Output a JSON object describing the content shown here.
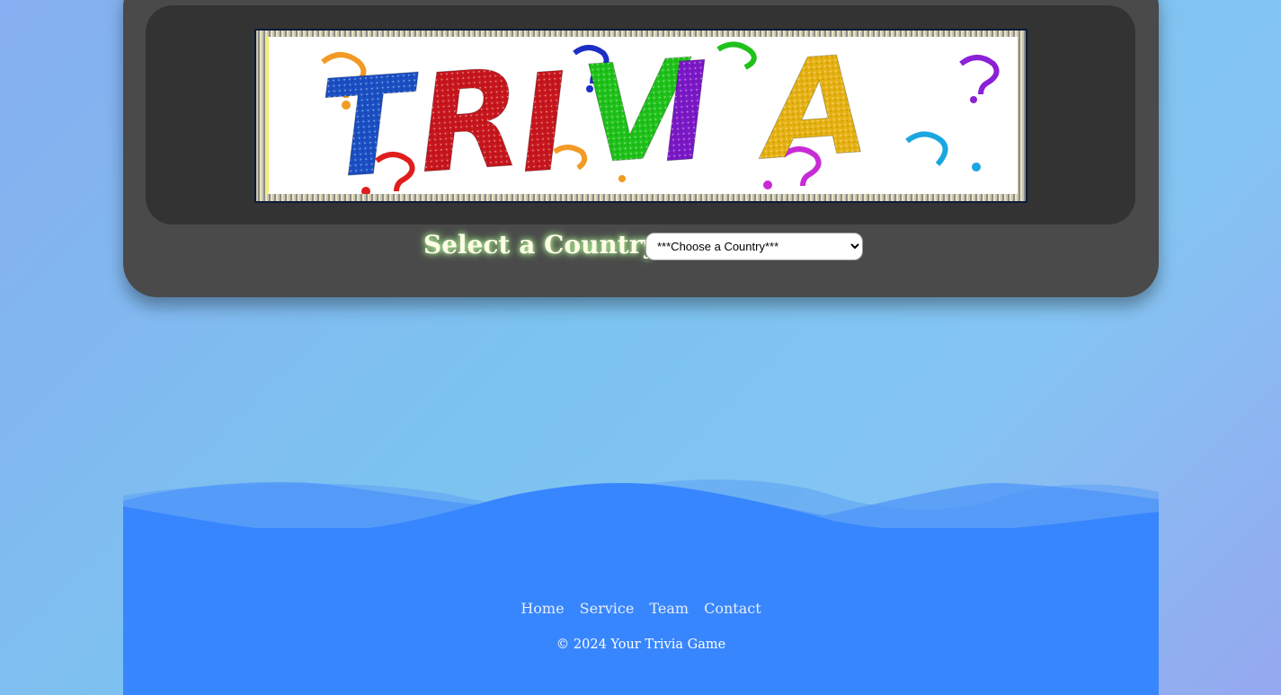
{
  "banner": {
    "logo_text": "TRIVIA",
    "letter_colors": [
      "#1a4fc4",
      "#c8161d",
      "#c8161d",
      "#1fc21a",
      "#7b18c7",
      "#e6b212",
      "#1aa6c4"
    ]
  },
  "country_selector": {
    "label": "Select a Country:",
    "selected_option": "***Choose a Country***"
  },
  "footer": {
    "nav": [
      {
        "label": "Home"
      },
      {
        "label": "Service"
      },
      {
        "label": "Team"
      },
      {
        "label": "Contact"
      }
    ],
    "copyright": "© 2024 Your Trivia Game",
    "background_color": "#3886fe"
  }
}
